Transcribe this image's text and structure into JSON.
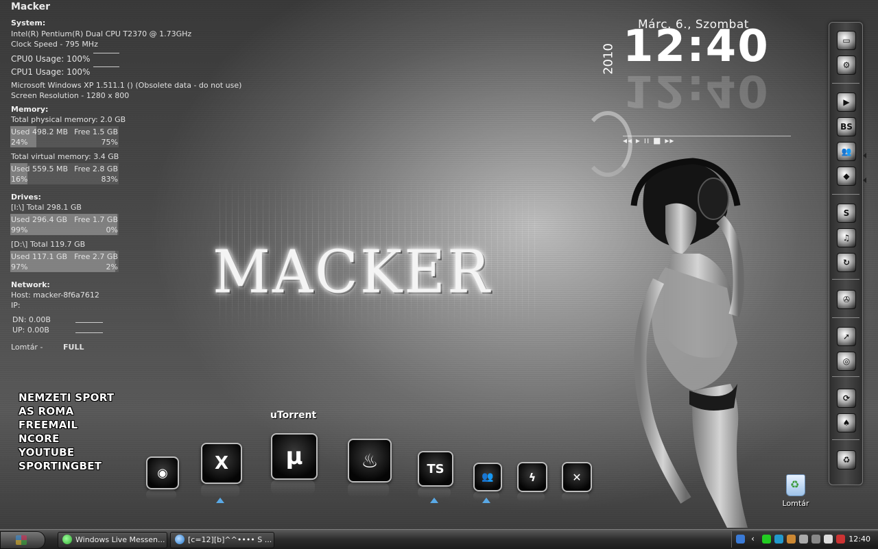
{
  "sysmon": {
    "title": "Macker",
    "system_header": "System:",
    "cpu_model": "Intel(R) Pentium(R) Dual  CPU  T2370  @ 1.73GHz",
    "clock_speed": "Clock Speed - 795 MHz",
    "cpu0": "CPU0 Usage: 100%",
    "cpu1": "CPU1 Usage: 100%",
    "os": "Microsoft Windows XP 1.511.1 () (Obsolete data - do not use)",
    "resolution": "Screen Resolution - 1280 x 800",
    "memory_header": "Memory:",
    "physical_total": "Total physical memory: 2.0 GB",
    "physical_used": "Used 498.2 MB",
    "physical_free": "Free 1.5 GB",
    "physical_used_pct": "24%",
    "physical_free_pct": "75%",
    "physical_fill": 24,
    "virtual_total": "Total virtual memory: 3.4 GB",
    "virtual_used": "Used 559.5 MB",
    "virtual_free": "Free 2.8 GB",
    "virtual_used_pct": "16%",
    "virtual_free_pct": "83%",
    "virtual_fill": 16,
    "drives_header": "Drives:",
    "drive_i": "[I:\\] Total 298.1 GB",
    "drive_i_used": "Used 296.4 GB",
    "drive_i_free": "Free 1.7 GB",
    "drive_i_used_pct": "99%",
    "drive_i_free_pct": "0%",
    "drive_i_fill": 99,
    "drive_d": "[D:\\] Total 119.7 GB",
    "drive_d_used": "Used 117.1 GB",
    "drive_d_free": "Free 2.7 GB",
    "drive_d_used_pct": "97%",
    "drive_d_free_pct": "2%",
    "drive_d_fill": 97,
    "network_header": "Network:",
    "host": "Host: macker-8f6a7612",
    "ip": "IP:",
    "dn": "DN:  0.00B",
    "up": "UP:  0.00B",
    "recycle_label": "Lomtár -",
    "recycle_status": "FULL"
  },
  "links": [
    "NEMZETI SPORT",
    "AS ROMA",
    "FREEMAIL",
    "NCORE",
    "YOUTUBE",
    "SPORTINGBET"
  ],
  "logo_text": "MACKER",
  "clock": {
    "date": "Márc. 6., Szombat",
    "year": "2010",
    "time": "12:40",
    "player": "◂◂ ▸ ıı ■ ▸▸"
  },
  "dock_label": "uTorrent",
  "bottom_dock": [
    {
      "name": "firefox",
      "glyph": "◉"
    },
    {
      "name": "xfire",
      "glyph": "X"
    },
    {
      "name": "utorrent",
      "glyph": "µ"
    },
    {
      "name": "nero",
      "glyph": "♨"
    },
    {
      "name": "teamspeak",
      "glyph": "TS"
    },
    {
      "name": "messenger",
      "glyph": "👥"
    },
    {
      "name": "winamp",
      "glyph": "ϟ"
    },
    {
      "name": "counter-strike",
      "glyph": "✕"
    }
  ],
  "right_dock": [
    {
      "name": "my-computer",
      "glyph": "▭"
    },
    {
      "name": "control-panel",
      "glyph": "⚙"
    },
    {
      "name": "media-player",
      "glyph": "▶"
    },
    {
      "name": "bs-player",
      "glyph": "BS"
    },
    {
      "name": "messenger",
      "glyph": "👥"
    },
    {
      "name": "ink",
      "glyph": "◆"
    },
    {
      "name": "skype",
      "glyph": "S"
    },
    {
      "name": "music",
      "glyph": "♫"
    },
    {
      "name": "refresh",
      "glyph": "↻"
    },
    {
      "name": "film-reel",
      "glyph": "✇"
    },
    {
      "name": "compass",
      "glyph": "➚"
    },
    {
      "name": "burner",
      "glyph": "◎"
    },
    {
      "name": "power",
      "glyph": "⟳"
    },
    {
      "name": "spade",
      "glyph": "♠"
    },
    {
      "name": "recycle",
      "glyph": "♻"
    }
  ],
  "desktop": {
    "recycle_bin": "Lomtár"
  },
  "taskbar": {
    "window1": "Windows Live Messen...",
    "window2": "[c=12][b]^^•••• S ...",
    "clock": "12:40"
  },
  "colors": {
    "accent_triangle": "#5aa9e6"
  }
}
